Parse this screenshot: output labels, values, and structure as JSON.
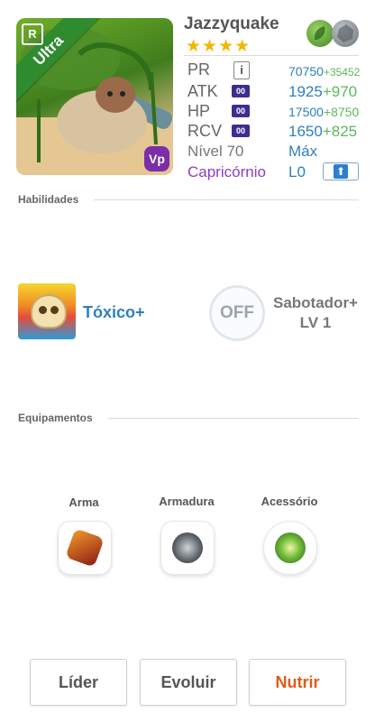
{
  "monster": {
    "name": "Jazzyquake",
    "stars": "★★★★",
    "badge": "Ultra",
    "rarity_letter": "R",
    "vp_mark": "Vp",
    "elements": [
      "leaf-icon",
      "rock-icon"
    ]
  },
  "stats": {
    "pr": {
      "label": "PR",
      "tag": "i",
      "value": "70750",
      "bonus": "+35452"
    },
    "atk": {
      "label": "ATK",
      "tag": "00",
      "value": "1925",
      "bonus": "+970"
    },
    "hp": {
      "label": "HP",
      "tag": "00",
      "value": "17500",
      "bonus": "+8750"
    },
    "rcv": {
      "label": "RCV",
      "tag": "00",
      "value": "1650",
      "bonus": "+825"
    },
    "level": {
      "label": "Nível 70",
      "value": "Máx"
    },
    "sign": {
      "label": "Capricórnio",
      "value": "L0"
    }
  },
  "skills": {
    "title": "Habilidades",
    "primary": {
      "name": "Tóxico+",
      "icon": "toxic-skull-icon"
    },
    "secondary": {
      "toggle": "OFF",
      "name": "Sabotador+",
      "level": "LV 1"
    }
  },
  "equipment": {
    "title": "Equipamentos",
    "slots": [
      {
        "label": "Arma",
        "icon": "weapon-claw-icon"
      },
      {
        "label": "Armadura",
        "icon": "armor-shield-icon"
      },
      {
        "label": "Acessório",
        "icon": "accessory-gem-icon"
      }
    ]
  },
  "actions": {
    "leader": "Líder",
    "evolve": "Evoluir",
    "feed": "Nutrir"
  },
  "colors": {
    "accent_blue": "#2e7fbf",
    "bonus_green": "#5cb85c",
    "sign_purple": "#8a3fbf",
    "feed_orange": "#e05a1a",
    "stars": "#f2b705"
  }
}
